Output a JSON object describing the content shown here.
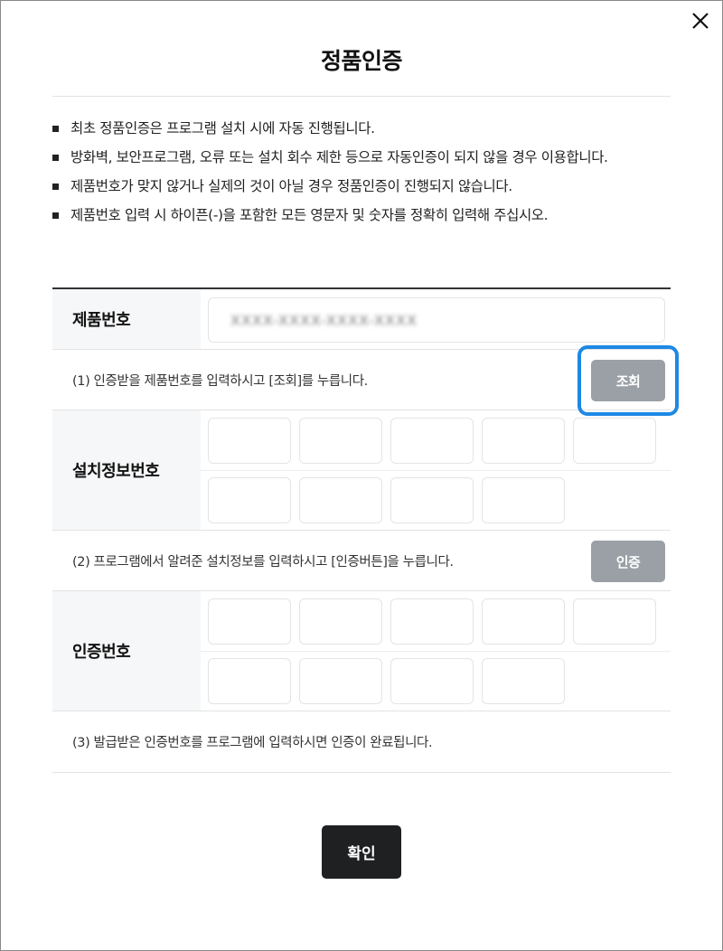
{
  "dialog": {
    "title": "정품인증",
    "close_label": "✕"
  },
  "notes": [
    "최초 정품인증은 프로그램 설치 시에 자동 진행됩니다.",
    "방화벽, 보안프로그램, 오류 또는 설치 회수 제한 등으로 자동인증이 되지 않을 경우 이용합니다.",
    "제품번호가 맞지 않거나 실제의 것이 아닐 경우 정품인증이 진행되지 않습니다.",
    "제품번호 입력 시 하이픈(-)을 포함한 모든 영문자 및 숫자를 정확히 입력해 주십시오."
  ],
  "product": {
    "label": "제품번호",
    "value": "XXXX-XXXX-XXXX-XXXX"
  },
  "step1": {
    "text": "(1) 인증받을 제품번호를 입력하시고 [조회]를 누릅니다.",
    "button_label": "조회"
  },
  "install_info": {
    "label": "설치정보번호"
  },
  "step2": {
    "text": "(2) 프로그램에서 알려준 설치정보를 입력하시고 [인증버튼]을 누릅니다.",
    "button_label": "인증"
  },
  "auth_number": {
    "label": "인증번호"
  },
  "step3": {
    "text": "(3) 발급받은 인증번호를 프로그램에 입력하시면 인증이 완료됩니다."
  },
  "footer": {
    "confirm_label": "확인"
  },
  "colors": {
    "highlight": "#1e88e5",
    "button_gray": "#9aa0a6",
    "confirm_dark": "#1f2022"
  }
}
